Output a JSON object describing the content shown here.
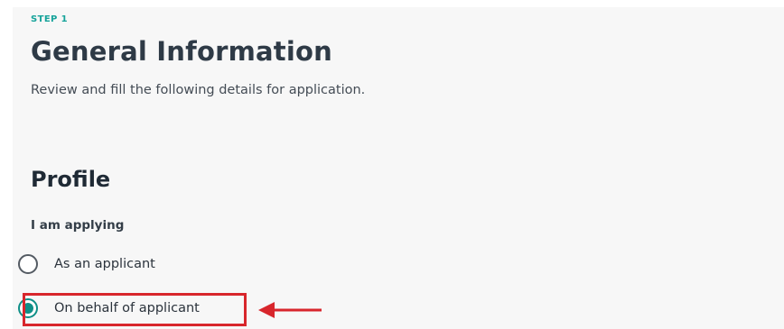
{
  "form": {
    "step_label": "STEP 1",
    "title": "General Information",
    "subtitle": "Review and fill the following details for application.",
    "profile": {
      "section_title": "Profile",
      "question_label": "I am applying",
      "options": [
        {
          "label": "As an applicant",
          "selected": false
        },
        {
          "label": "On behalf of applicant",
          "selected": true
        }
      ]
    }
  },
  "colors": {
    "accent": "#0e8f87",
    "step_label": "#16a39a",
    "highlight": "#d8262c",
    "panel_background": "#f7f7f7"
  },
  "annotations": {
    "highlight_box": "red rectangle around selected option",
    "arrow_icon": "red-left-arrow-icon"
  }
}
